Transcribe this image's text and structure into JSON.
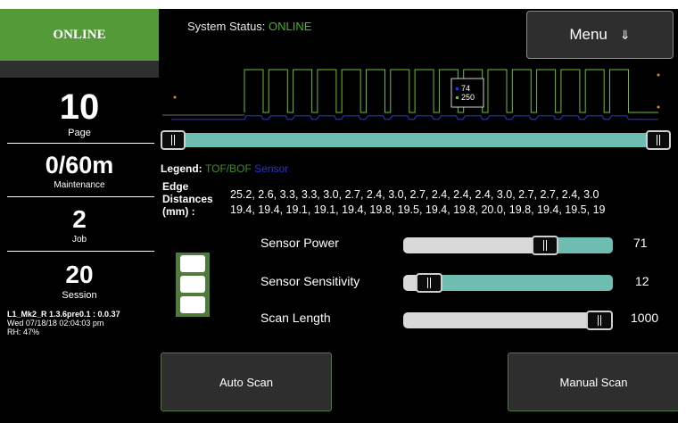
{
  "sidebar": {
    "status": "ONLINE",
    "page": {
      "value": "10",
      "label": "Page"
    },
    "maintenance": {
      "value": "0/60m",
      "label": "Maintenance"
    },
    "job": {
      "value": "2",
      "label": "Job"
    },
    "session": {
      "value": "20",
      "label": "Session"
    },
    "version": "L1_Mk2_R 1.3.6pre0.1 : 0.0.37",
    "datetime": "Wed 07/18/18 02:04:03 pm",
    "humidity": "RH: 47%"
  },
  "header": {
    "status_label": "System Status:",
    "status_value": "ONLINE",
    "menu_label": "Menu",
    "menu_icon": "arrow-down-icon"
  },
  "chart_data": {
    "type": "line",
    "title": "",
    "xlabel": "",
    "ylabel": "",
    "pulses": 16,
    "series": [
      {
        "name": "TOF/BOF",
        "color": "#6abf2f",
        "high": 250,
        "low": 0
      },
      {
        "name": "Sensor",
        "color": "#2233ff",
        "high": 74
      }
    ],
    "tooltip": {
      "values": [
        "74",
        "250"
      ]
    },
    "legend_position": "bottom"
  },
  "legend": {
    "label": "Legend:",
    "tof": "TOF/BOF",
    "sensor": "Sensor"
  },
  "edge": {
    "label_line1": "Edge",
    "label_line2": "Distances",
    "label_line3": "(mm) :",
    "row1": "25.2, 2.6, 3.3, 3.3, 3.0, 2.7, 2.4, 3.0, 2.7, 2.4, 2.4, 2.4, 3.0, 2.7, 2.7, 2.4, 3.0",
    "row2": "19.4, 19.4, 19.1, 19.1, 19.4, 19.8, 19.5, 19.4, 19.8, 20.0, 19.8, 19.4, 19.5, 19"
  },
  "sliders": {
    "power": {
      "label": "Sensor Power",
      "value": "71",
      "fraction": 0.7
    },
    "sensitivity": {
      "label": "Sensor Sensitivity",
      "value": "12",
      "fraction": 0.07
    },
    "scan_length": {
      "label": "Scan Length",
      "value": "1000",
      "fraction": 1.0
    }
  },
  "buttons": {
    "auto_scan": "Auto Scan",
    "manual_scan": "Manual Scan"
  },
  "colors": {
    "online_green": "#559a39",
    "teal": "#6dbdb0",
    "tof_green": "#6abf2f",
    "sensor_blue": "#2233ff"
  }
}
